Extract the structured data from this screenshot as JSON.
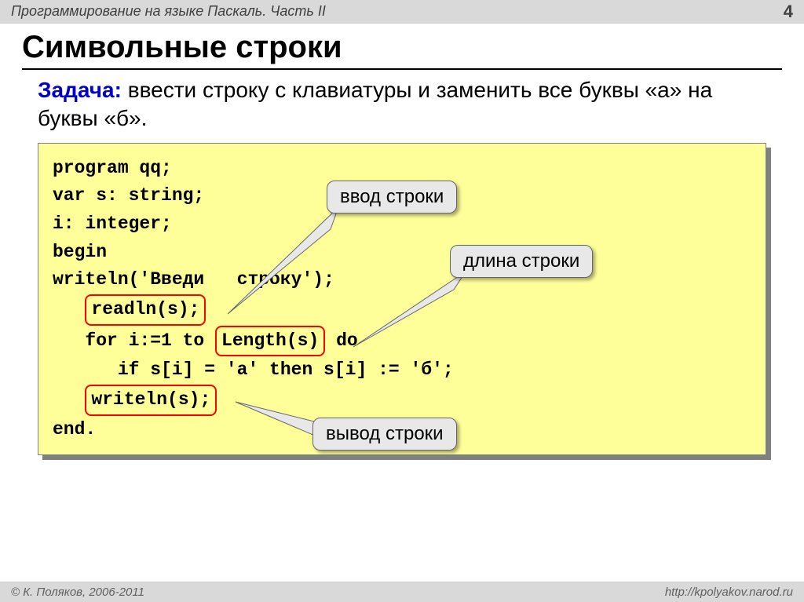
{
  "header": {
    "title": "Программирование на языке Паскаль. Часть II",
    "page": "4"
  },
  "heading": "Символьные строки",
  "task": {
    "label": "Задача:",
    "text": " ввести строку с клавиатуры и заменить все буквы «а» на буквы «б»."
  },
  "code": {
    "l1": "program qq;",
    "l2": "var s: string;",
    "l3": "    i: integer;",
    "l4": "begin",
    "l5a": "   writeln('Введи",
    "l5b": " строку');",
    "l6a": "   ",
    "l6hl": "readln(s);",
    "l7a": "   for i:=1 to ",
    "l7hl": "Length(s)",
    "l7b": " do",
    "l8": "      if s[i] = 'а' then s[i] := 'б';",
    "l9a": "   ",
    "l9hl": "writeln(s);",
    "l10": "end."
  },
  "callouts": {
    "input": "ввод строки",
    "length": "длина строки",
    "output": "вывод строки"
  },
  "footer": {
    "left": "© К. Поляков, 2006-2011",
    "right": "http://kpolyakov.narod.ru"
  }
}
